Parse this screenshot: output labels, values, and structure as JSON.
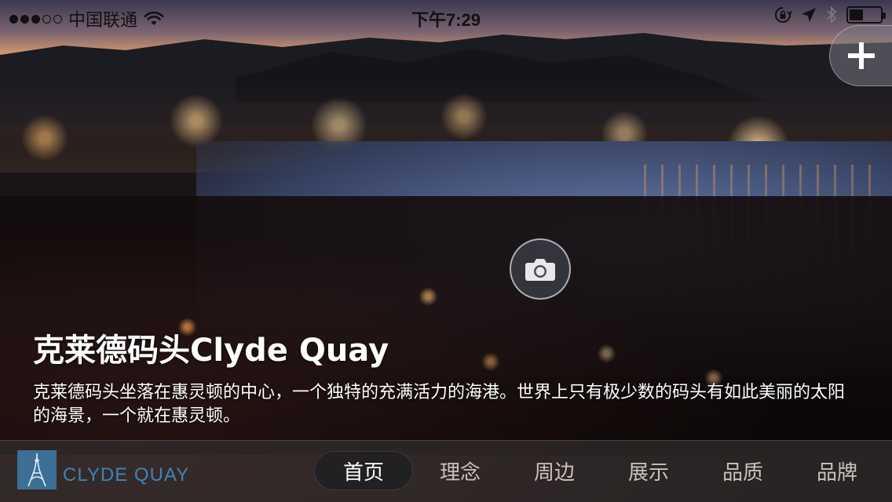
{
  "status_bar": {
    "signal_dots_filled": 3,
    "signal_dots_total": 5,
    "carrier": "中国联通",
    "time": "下午7:29",
    "icons": [
      "wifi-icon",
      "rotation-lock-icon",
      "location-arrow-icon",
      "bluetooth-icon",
      "battery-icon"
    ],
    "battery_level": 0.45
  },
  "hero": {
    "title": "克莱德码头Clyde Quay",
    "description": "克莱德码头坐落在惠灵顿的中心，一个独特的充满活力的海港。世界上只有极少数的码头有如此美丽的太阳的海景，一个就在惠灵顿。"
  },
  "actions": {
    "add_icon": "plus-icon",
    "camera_icon": "camera-icon"
  },
  "brand": {
    "logo_icon": "eiffel-tower-icon",
    "name": "CLYDE QUAY",
    "color": "#3d84b8"
  },
  "tabs": [
    {
      "label": "首页",
      "active": true
    },
    {
      "label": "理念",
      "active": false
    },
    {
      "label": "周边",
      "active": false
    },
    {
      "label": "展示",
      "active": false
    },
    {
      "label": "品质",
      "active": false
    },
    {
      "label": "品牌",
      "active": false
    }
  ]
}
